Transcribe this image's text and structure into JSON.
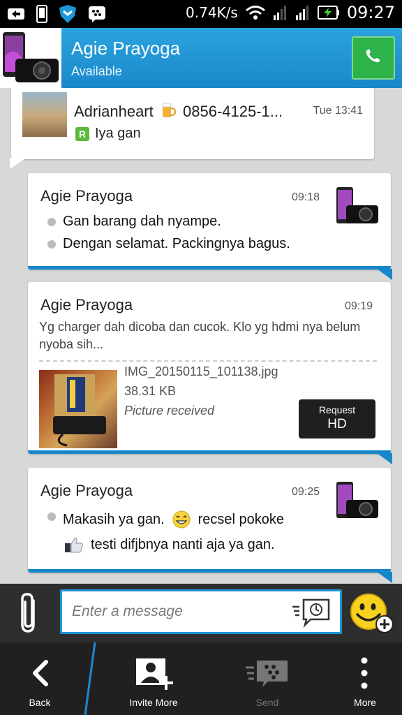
{
  "status_bar": {
    "net_speed": "0.74K/s",
    "clock": "09:27"
  },
  "header": {
    "contact_name": "Agie Prayoga",
    "contact_status": "Available"
  },
  "messages": {
    "quote": {
      "name": "Adrianheart",
      "phone": "0856-4125-1...",
      "time": "Tue 13:41",
      "text": "Iya gan",
      "badge": "R"
    },
    "m1": {
      "sender": "Agie Prayoga",
      "time": "09:18",
      "lines": [
        "Gan barang dah nyampe.",
        "Dengan selamat. Packingnya bagus."
      ]
    },
    "m2": {
      "sender": "Agie Prayoga",
      "time": "09:19",
      "caption": "Yg charger dah dicoba dan cucok. Klo yg hdmi nya belum nyoba sih...",
      "file_name": "IMG_20150115_101138.jpg",
      "file_size": "38.31 KB",
      "file_status": "Picture received",
      "hd_button_line1": "Request",
      "hd_button_line2": "HD"
    },
    "m3": {
      "sender": "Agie Prayoga",
      "time": "09:25",
      "line1": "Makasih ya gan.",
      "line1_suffix": "recsel pokoke",
      "line2": "testi difjbnya nanti aja ya gan."
    }
  },
  "composer": {
    "placeholder": "Enter a message"
  },
  "bottom_nav": {
    "back": "Back",
    "invite": "Invite More",
    "send": "Send",
    "more": "More"
  },
  "colors": {
    "header_blue": "#2ba3de",
    "accent_blue": "#1787c9",
    "call_green": "#2db34a"
  }
}
